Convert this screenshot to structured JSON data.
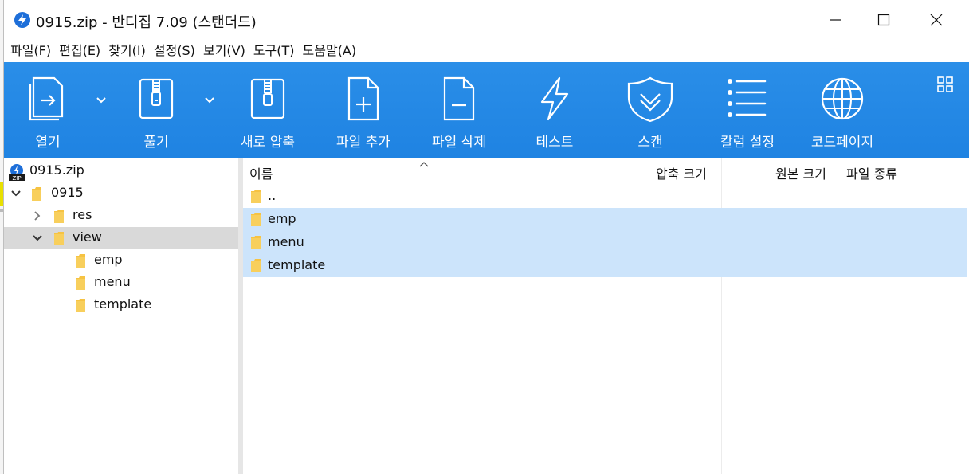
{
  "window": {
    "title": "0915.zip - 반디집 7.09 (스탠더드)"
  },
  "menu": [
    {
      "label": "파일(F)"
    },
    {
      "label": "편집(E)"
    },
    {
      "label": "찾기(I)"
    },
    {
      "label": "설정(S)"
    },
    {
      "label": "보기(V)"
    },
    {
      "label": "도구(T)"
    },
    {
      "label": "도움말(A)"
    }
  ],
  "toolbar": {
    "open": "열기",
    "extract": "풀기",
    "new_archive": "새로 압축",
    "add_file": "파일 추가",
    "delete_file": "파일 삭제",
    "test": "테스트",
    "scan": "스캔",
    "column_settings": "칼럼 설정",
    "codepage": "코드페이지"
  },
  "tree": {
    "items": [
      {
        "label": "0915.zip"
      },
      {
        "label": "0915"
      },
      {
        "label": "res"
      },
      {
        "label": "view"
      },
      {
        "label": "emp"
      },
      {
        "label": "menu"
      },
      {
        "label": "template"
      }
    ],
    "selected": "view"
  },
  "list": {
    "columns": {
      "name": "이름",
      "compressed_size": "압축 크기",
      "original_size": "원본 크기",
      "file_type": "파일 종류"
    },
    "rows": [
      {
        "name": "..",
        "selected": false
      },
      {
        "name": "emp",
        "selected": true
      },
      {
        "name": "menu",
        "selected": true
      },
      {
        "name": "template",
        "selected": true
      }
    ]
  },
  "colors": {
    "toolbar_bg": "#1f83e2",
    "selection": "#cce4fb",
    "tree_selection": "#d9d9d9",
    "folder": "#f6c343"
  }
}
